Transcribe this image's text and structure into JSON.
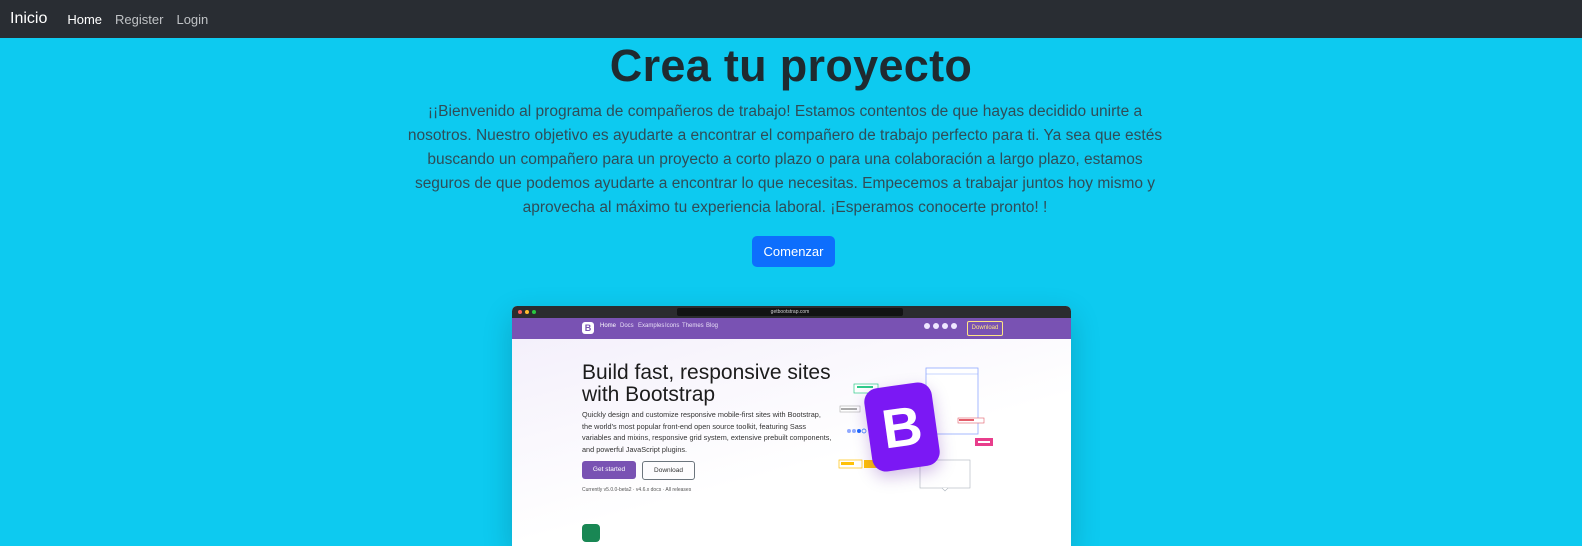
{
  "navbar": {
    "brand": "Inicio",
    "links": [
      "Home",
      "Register",
      "Login"
    ]
  },
  "hero": {
    "title": "Crea tu proyecto",
    "text": "¡¡Bienvenido al programa de compañeros de trabajo! Estamos contentos de que hayas decidido unirte a nosotros. Nuestro objetivo es ayudarte a encontrar el compañero de trabajo perfecto para ti. Ya sea que estés buscando un compañero para un proyecto a corto plazo o para una colaboración a largo plazo, estamos seguros de que podemos ayudarte a encontrar lo que necesitas. Empecemos a trabajar juntos hoy mismo y aprovecha al máximo tu experiencia laboral. ¡Esperamos conocerte pronto! !",
    "cta_label": "Comenzar"
  },
  "preview": {
    "url": "getbootstrap.com",
    "nav_links": [
      "Home",
      "Docs",
      "Examples",
      "Icons",
      "Themes",
      "Blog"
    ],
    "nav_download": "Download",
    "headline": "Build fast, responsive sites with Bootstrap",
    "description": "Quickly design and customize responsive mobile-first sites with Bootstrap, the world's most popular front-end open source toolkit, featuring Sass variables and mixins, responsive grid system, extensive prebuilt components, and powerful JavaScript plugins.",
    "primary_button": "Get started",
    "secondary_button": "Download",
    "footnote": "Currently v5.0.0-beta2 · v4.6.x docs · All releases",
    "logo_letter": "B"
  },
  "colors": {
    "background": "#0dcaf0",
    "navbar": "#292d33",
    "button": "#0d6efd",
    "bootstrap_purple": "#7952b3",
    "logo_purple": "#7b18f4"
  }
}
